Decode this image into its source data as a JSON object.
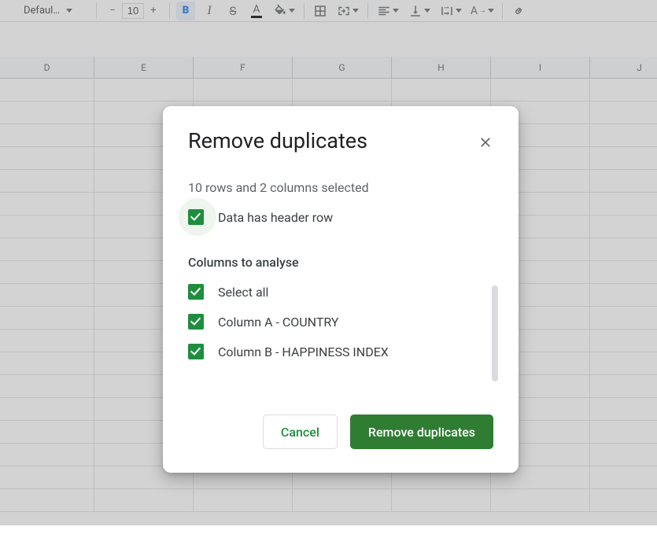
{
  "toolbar": {
    "font_family": "Defaul…",
    "font_size": "10"
  },
  "grid": {
    "columns": [
      "D",
      "E",
      "F",
      "G",
      "H",
      "I",
      "J"
    ]
  },
  "dialog": {
    "title": "Remove duplicates",
    "selection_summary": "10 rows and 2 columns selected",
    "header_checkbox_label": "Data has header row",
    "section_title": "Columns to analyse",
    "columns": [
      {
        "label": "Select all"
      },
      {
        "label": "Column A - COUNTRY"
      },
      {
        "label": "Column B - HAPPINESS INDEX"
      }
    ],
    "cancel_label": "Cancel",
    "confirm_label": "Remove duplicates"
  }
}
